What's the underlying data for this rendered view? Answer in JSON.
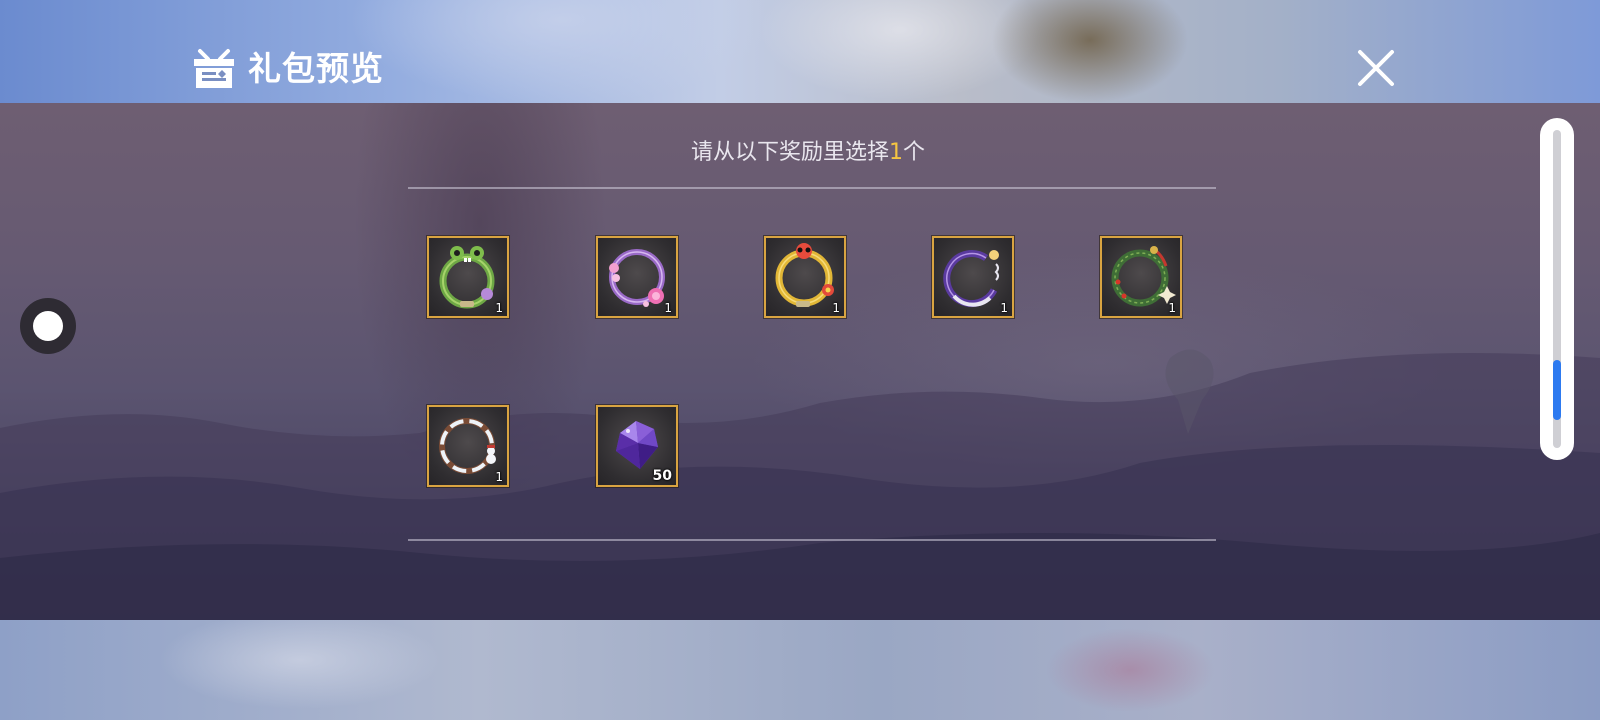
{
  "header": {
    "title": "礼包预览",
    "gift_icon": "gift-box-icon",
    "close_icon": "close-icon"
  },
  "instruction": {
    "prefix": "请从以下奖励里选择",
    "count": "1",
    "suffix": "个"
  },
  "items": [
    {
      "name": "frog-frame",
      "icon": "frog-avatar-frame-icon",
      "quantity": "1"
    },
    {
      "name": "flower-frame",
      "icon": "pink-flower-avatar-frame-icon",
      "quantity": "1"
    },
    {
      "name": "chick-frame",
      "icon": "yellow-chick-avatar-frame-icon",
      "quantity": "1"
    },
    {
      "name": "moon-frame",
      "icon": "purple-moon-avatar-frame-icon",
      "quantity": "1"
    },
    {
      "name": "wreath-frame",
      "icon": "christmas-wreath-avatar-frame-icon",
      "quantity": "1"
    },
    {
      "name": "snow-frame",
      "icon": "snowman-avatar-frame-icon",
      "quantity": "1"
    },
    {
      "name": "crystal",
      "icon": "purple-crystal-icon",
      "quantity": "50"
    }
  ],
  "colors": {
    "item_border": "#d9a441",
    "highlight_number": "#f5c542",
    "scroll_thumb": "#2d7af0"
  },
  "scroll": {
    "position_fraction": 0.75
  }
}
